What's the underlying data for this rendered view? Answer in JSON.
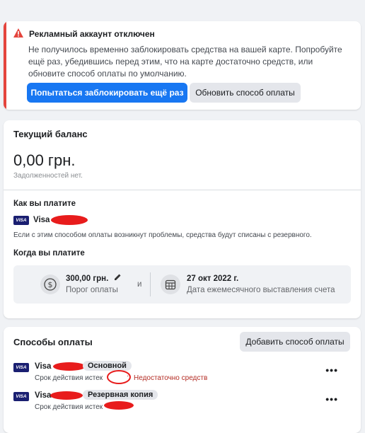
{
  "alert": {
    "title": "Рекламный аккаунт отключен",
    "message": "Не получилось временно заблокировать средства на вашей карте. Попробуйте ещё раз, убедившись перед этим, что на карте достаточно средств, или обновите способ оплаты по умолчанию.",
    "retry_label": "Попытаться заблокировать ещё раз",
    "update_label": "Обновить способ оплаты",
    "color": "#e4443c"
  },
  "balance": {
    "title": "Текущий баланс",
    "amount": "0,00 грн.",
    "debt_note": "Задолженностей нет."
  },
  "payment": {
    "how_title": "Как вы платите",
    "card_brand": "Visa",
    "card_badge": "VISA",
    "fallback_note": "Если с этим способом оплаты возникнут проблемы, средства будут списаны с резервного.",
    "when_title": "Когда вы платите",
    "threshold_value": "300,00 грн.",
    "threshold_label": "Порог оплаты",
    "and_label": "и",
    "date_value": "27 окт 2022 г.",
    "date_label": "Дата ежемесячного выставления счета"
  },
  "methods": {
    "title": "Способы оплаты",
    "add_label": "Добавить способ оплаты",
    "items": [
      {
        "badge": "VISA",
        "brand": "Visa",
        "tag": "Основной",
        "expiry": "Срок действия истек",
        "status": "Недостаточно средств",
        "menu": "•••"
      },
      {
        "badge": "VISA",
        "brand": "Visa",
        "tag": "Резервная копия",
        "expiry": "Срок действия истек",
        "status": "",
        "menu": "•••"
      }
    ]
  }
}
